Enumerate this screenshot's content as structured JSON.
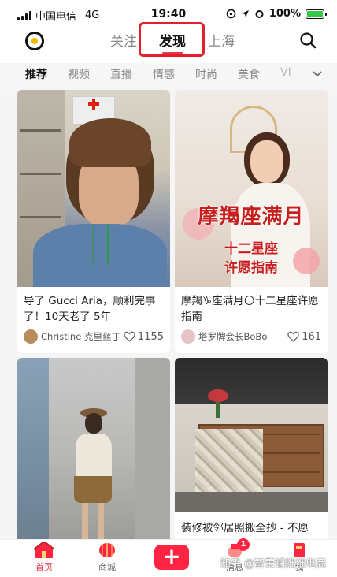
{
  "status_bar": {
    "carrier": "中国电信",
    "network": "4G",
    "time": "19:40",
    "battery": "100%",
    "battery_level": 1.0
  },
  "top_nav": {
    "tabs": [
      {
        "label": "关注"
      },
      {
        "label": "发现"
      },
      {
        "label": "上海"
      }
    ],
    "active_tab": "发现"
  },
  "categories": {
    "items": [
      "推荐",
      "视频",
      "直播",
      "情感",
      "时尚",
      "美食",
      "VI"
    ],
    "active": "推荐"
  },
  "feed": {
    "cards": [
      {
        "title": "导了 Gucci Aria，顺利完事了！10天老了 5年",
        "author": "Christine 克里丝丁",
        "likes": "1155",
        "avatar_color": "#b98a5a"
      },
      {
        "title": "摩羯♑座满月🌕十二星座许愿指南",
        "author": "塔罗牌会长BoBo",
        "likes": "161",
        "avatar_color": "#e7c3c6",
        "image_text_main": "摩羯座满月",
        "image_text_sub": "十二星座\n许愿指南"
      },
      {
        "title": "",
        "author": "",
        "likes": ""
      },
      {
        "title": "装修被邻居照搬全抄 - 不愿",
        "author": "",
        "likes": ""
      }
    ]
  },
  "bottom_nav": {
    "items": [
      {
        "label": "首页"
      },
      {
        "label": "商城"
      },
      {
        "label": "消息"
      },
      {
        "label": "我"
      }
    ],
    "add_label": "+",
    "message_badge": "1"
  },
  "watermark": "知乎 @智荣铺推推电商",
  "colors": {
    "accent": "#ff2442",
    "highlight_box": "#e0202b",
    "active_text": "#111111",
    "inactive_text": "#888888"
  }
}
